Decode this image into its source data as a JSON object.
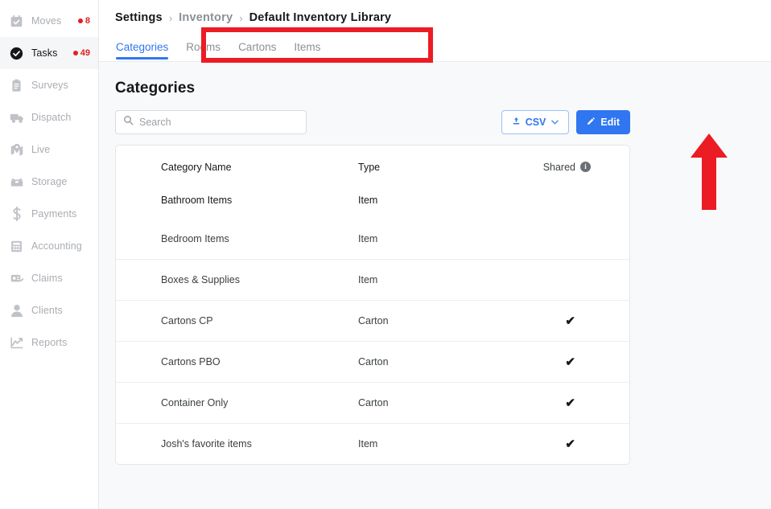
{
  "sidebar": {
    "items": [
      {
        "label": "Moves",
        "icon": "calendar-check-icon",
        "badge": "8",
        "active": false
      },
      {
        "label": "Tasks",
        "icon": "check-circle-icon",
        "badge": "49",
        "active": true
      },
      {
        "label": "Surveys",
        "icon": "clipboard-icon",
        "badge": "",
        "active": false
      },
      {
        "label": "Dispatch",
        "icon": "truck-icon",
        "badge": "",
        "active": false
      },
      {
        "label": "Live",
        "icon": "map-pin-icon",
        "badge": "",
        "active": false
      },
      {
        "label": "Storage",
        "icon": "open-box-icon",
        "badge": "",
        "active": false
      },
      {
        "label": "Payments",
        "icon": "dollar-icon",
        "badge": "",
        "active": false
      },
      {
        "label": "Accounting",
        "icon": "calculator-icon",
        "badge": "",
        "active": false
      },
      {
        "label": "Claims",
        "icon": "document-edit-icon",
        "badge": "",
        "active": false
      },
      {
        "label": "Clients",
        "icon": "person-icon",
        "badge": "",
        "active": false
      },
      {
        "label": "Reports",
        "icon": "line-chart-icon",
        "badge": "",
        "active": false
      }
    ]
  },
  "breadcrumb": {
    "root": "Settings",
    "separator": "›",
    "middle": "Inventory",
    "current": "Default Inventory Library"
  },
  "tabs": [
    {
      "label": "Categories",
      "active": true
    },
    {
      "label": "Rooms",
      "active": false
    },
    {
      "label": "Cartons",
      "active": false
    },
    {
      "label": "Items",
      "active": false
    }
  ],
  "page": {
    "title": "Categories"
  },
  "search": {
    "value": "",
    "placeholder": "Search",
    "icon": "search-icon"
  },
  "toolbar": {
    "csv_label": "CSV",
    "csv_icon": "upload-icon",
    "csv_chevron": "chevron-down-icon",
    "edit_label": "Edit",
    "edit_icon": "pencil-icon"
  },
  "table": {
    "headers": {
      "name": "Category Name",
      "type": "Type",
      "shared": "Shared",
      "shared_info_icon": "info-icon",
      "info_glyph": "i"
    },
    "check_glyph": "✔",
    "rows": [
      {
        "name": "Bathroom Items",
        "type": "Item",
        "shared": false
      },
      {
        "name": "Bedroom Items",
        "type": "Item",
        "shared": false
      },
      {
        "name": "Boxes & Supplies",
        "type": "Item",
        "shared": false
      },
      {
        "name": "Cartons CP",
        "type": "Carton",
        "shared": true
      },
      {
        "name": "Cartons PBO",
        "type": "Carton",
        "shared": true
      },
      {
        "name": "Container Only",
        "type": "Carton",
        "shared": true
      },
      {
        "name": "Josh's favorite items",
        "type": "Item",
        "shared": true
      }
    ]
  },
  "annotations": {
    "color": "#ec1c24",
    "rect_target": "tabs-bar",
    "arrow_target": "edit-button"
  },
  "colors": {
    "accent": "#2f76f0",
    "badge": "#e02020",
    "annotation": "#ec1c24",
    "page_bg": "#f8f9fa"
  }
}
